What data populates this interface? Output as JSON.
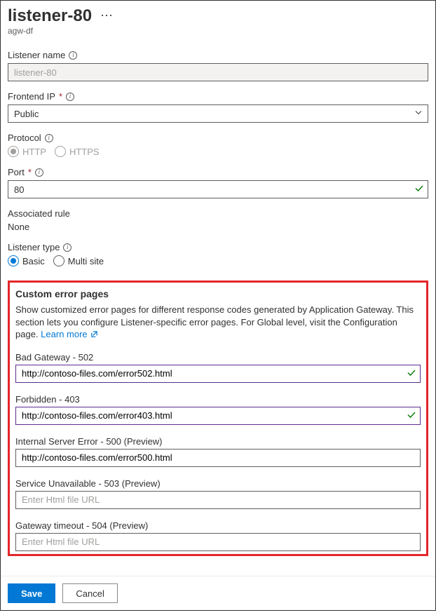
{
  "header": {
    "title": "listener-80",
    "subtitle": "agw-df",
    "more_icon": "more-icon"
  },
  "fields": {
    "listener_name": {
      "label": "Listener name",
      "value": "listener-80"
    },
    "frontend_ip": {
      "label": "Frontend IP",
      "value": "Public"
    },
    "protocol": {
      "label": "Protocol",
      "options": {
        "http": "HTTP",
        "https": "HTTPS"
      },
      "selected": "http"
    },
    "port": {
      "label": "Port",
      "value": "80"
    },
    "associated_rule": {
      "label": "Associated rule",
      "value": "None"
    },
    "listener_type": {
      "label": "Listener type",
      "options": {
        "basic": "Basic",
        "multi": "Multi site"
      },
      "selected": "basic"
    }
  },
  "custom_error": {
    "heading": "Custom error pages",
    "desc": "Show customized error pages for different response codes generated by Application Gateway. This section lets you configure Listener-specific error pages. For Global level, visit the Configuration page.",
    "learn_more": "Learn more",
    "placeholder": "Enter Html file URL",
    "items": [
      {
        "label": "Bad Gateway - 502",
        "value": "http://contoso-files.com/error502.html",
        "state": "valid"
      },
      {
        "label": "Forbidden - 403",
        "value": "http://contoso-files.com/error403.html",
        "state": "valid"
      },
      {
        "label": "Internal Server Error - 500 (Preview)",
        "value": "http://contoso-files.com/error500.html",
        "state": "filled"
      },
      {
        "label": "Service Unavailable - 503 (Preview)",
        "value": "",
        "state": "empty"
      },
      {
        "label": "Gateway timeout - 504 (Preview)",
        "value": "",
        "state": "empty"
      }
    ]
  },
  "footer": {
    "save": "Save",
    "cancel": "Cancel"
  }
}
